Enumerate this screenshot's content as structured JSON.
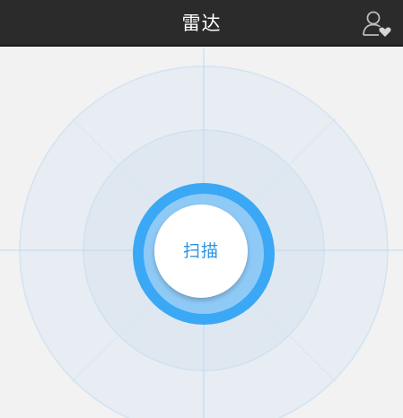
{
  "header": {
    "title": "雷达",
    "user_icon": "user-heart-icon"
  },
  "radar": {
    "scan_label": "扫描",
    "colors": {
      "ring_outer": "#3aa8f5",
      "ring_inner": "#8fcaf7",
      "label": "#2a94e6",
      "header_bg": "#2b2b2b"
    }
  }
}
